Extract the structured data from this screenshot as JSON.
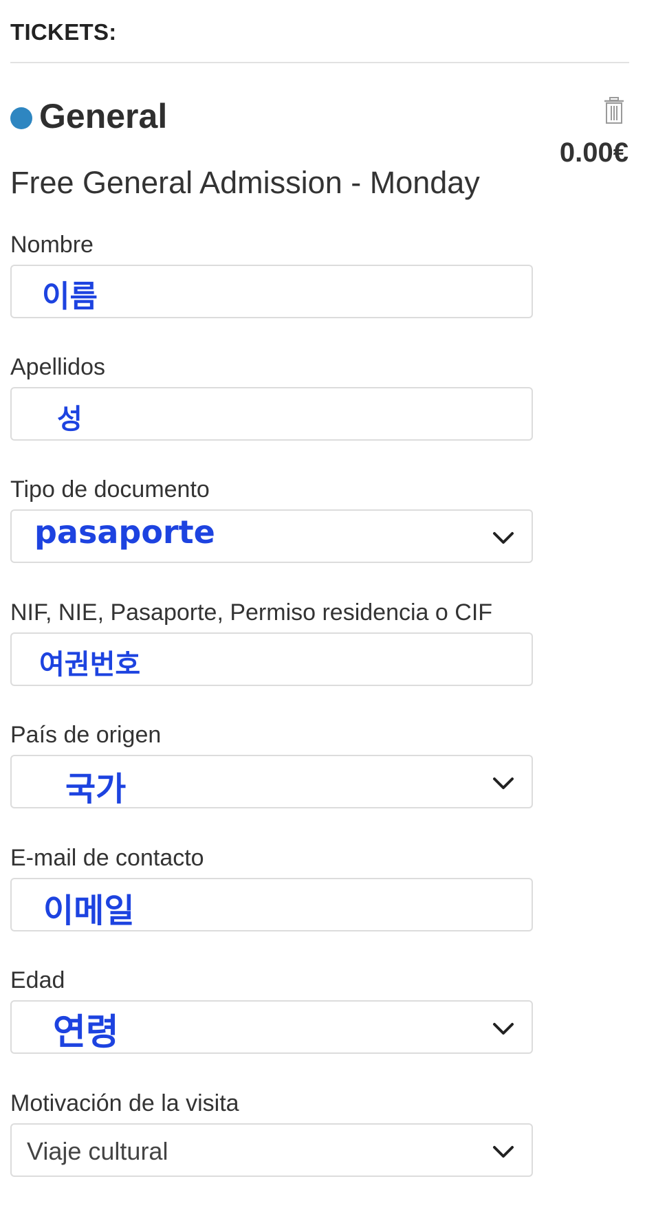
{
  "section_title": "TICKETS:",
  "ticket": {
    "name": "General",
    "dot_color": "#2e86c1",
    "price": "0.00€",
    "description": "Free General Admission - Monday"
  },
  "fields": {
    "nombre": {
      "label": "Nombre",
      "value": "이름"
    },
    "apellidos": {
      "label": "Apellidos",
      "value": "성"
    },
    "tipo_documento": {
      "label": "Tipo de documento",
      "value": "pasaporte"
    },
    "documento": {
      "label": "NIF, NIE, Pasaporte, Permiso residencia o CIF",
      "value": "여권번호"
    },
    "pais": {
      "label": "País de origen",
      "value": "국가"
    },
    "email": {
      "label": "E-mail de contacto",
      "value": "이메일"
    },
    "edad": {
      "label": "Edad",
      "value": "연령"
    },
    "motivacion": {
      "label": "Motivación de la visita",
      "value": "Viaje cultural"
    }
  },
  "colors": {
    "annotation": "#1d43e0",
    "border": "#dcdcdc"
  },
  "icons": {
    "delete": "trash-icon",
    "dropdown": "chevron-down-icon"
  }
}
